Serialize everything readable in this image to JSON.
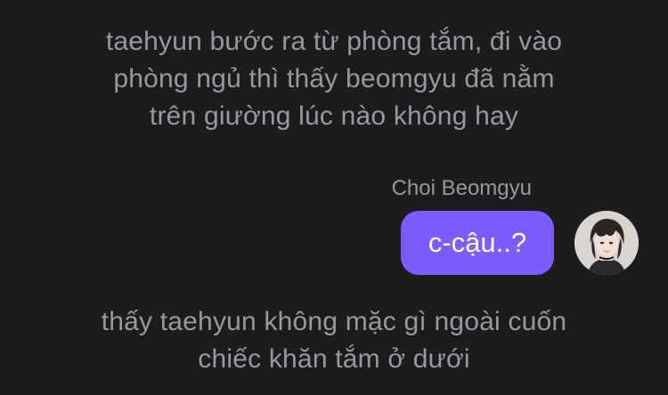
{
  "narration_top": {
    "lines": [
      "taehyun bước ra từ phòng tắm, đi vào",
      "phòng ngủ thì thấy beomgyu đã nằm",
      "trên giường lúc nào không hay"
    ]
  },
  "message": {
    "sender": "Choi Beomgyu",
    "text": "c-cậu..?",
    "bubble_color": "#7b5cff",
    "avatar_icon": "profile-photo-avatar"
  },
  "narration_bottom": {
    "lines": [
      "thấy taehyun không mặc gì ngoài cuốn",
      "chiếc khăn tắm ở dưới"
    ]
  },
  "colors": {
    "background": "#1c1c1e",
    "narration_text": "#98989d",
    "bubble_text": "#ffffff"
  }
}
